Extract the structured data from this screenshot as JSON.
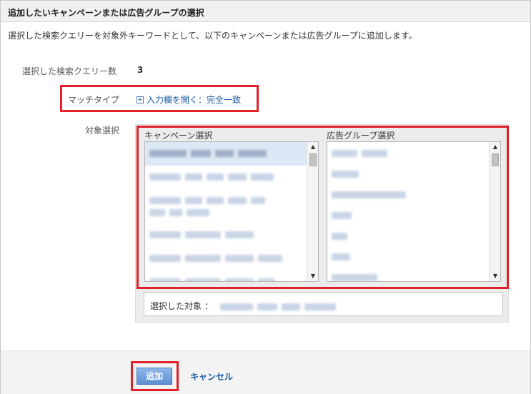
{
  "dialog": {
    "title": "追加したいキャンペーンまたは広告グループの選択",
    "description": "選択した検索クエリーを対象外キーワードとして、以下のキャンペーンまたは広告グループに追加します。"
  },
  "selected_query_count": {
    "label": "選択した検索クエリー数",
    "value": "3"
  },
  "match_type": {
    "label": "マッチタイプ",
    "expand_icon": "plus-box-icon",
    "link_text": "入力欄を開く：完全一致"
  },
  "target": {
    "label": "対象選択",
    "campaign_list_title": "キャンペーン選択",
    "adgroup_list_title": "広告グループ選択",
    "selected_label": "選択した対象 ："
  },
  "footer": {
    "add_label": "追加",
    "cancel_label": "キャンセル"
  },
  "colors": {
    "highlight": "#e0202a",
    "link": "#1a5aa6",
    "primary_button": "#5e8fd2"
  }
}
